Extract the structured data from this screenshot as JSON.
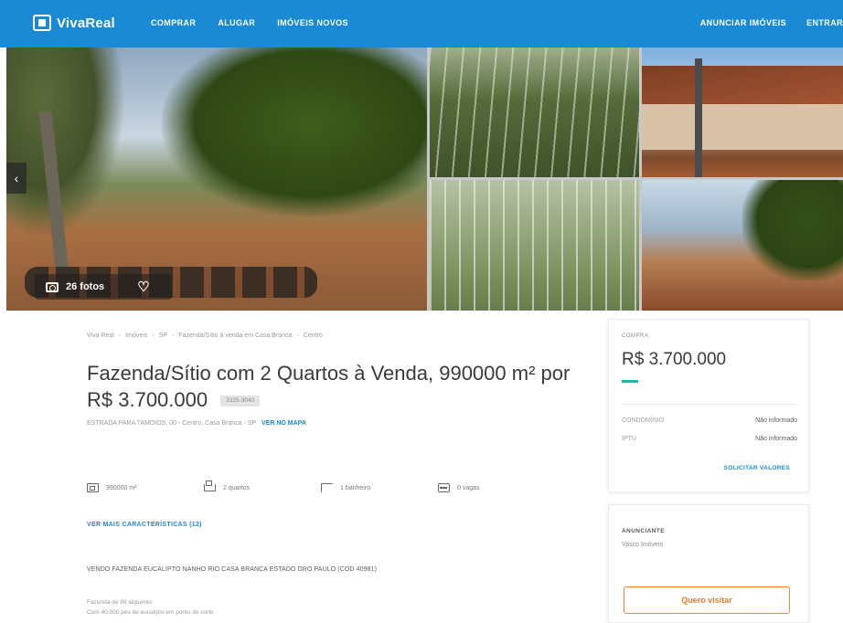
{
  "header": {
    "logo_text": "VivaReal",
    "nav_left": [
      "COMPRAR",
      "ALUGAR",
      "IMÓVEIS NOVOS"
    ],
    "nav_right": [
      "ANUNCIAR IMÓVEIS",
      "ENTRAR"
    ],
    "brand_color": "#1a8ad4"
  },
  "gallery": {
    "photo_count_label": "26 fotos",
    "prev_icon": "chevron-left-icon",
    "favorite_icon": "heart-icon",
    "camera_icon": "camera-icon"
  },
  "breadcrumb": [
    "Viva Real",
    "Imóveis",
    "SP",
    "Fazenda/Sítio à venda em Casa Branca",
    "Centro"
  ],
  "listing": {
    "title": "Fazenda/Sítio com 2 Quartos à Venda, 990000 m² por R$ 3.700.000",
    "code": "3325-3040",
    "address": "ESTRADA PARA TAMOIOS, 00 - Centro, Casa Branca - SP",
    "map_link": "VER NO MAPA",
    "amenities": [
      {
        "icon": "area-icon",
        "label": "990000 m²"
      },
      {
        "icon": "bed-icon",
        "label": "2 quartos"
      },
      {
        "icon": "bath-icon",
        "label": "1 banheiro"
      },
      {
        "icon": "car-icon",
        "label": "0 vagas"
      }
    ],
    "see_more": "VER MAIS CARACTERÍSTICAS (12)",
    "description_head": "VENDO FAZENDA EUCALIPTO NANHO RIO CASA BRANCA ESTADO DRO PAULO (COD 40981)",
    "description_lines": [
      "Fazenda de 99 alqueires",
      "Com 40.000 pés de eucalipto em ponto de corte"
    ]
  },
  "price_card": {
    "label": "COMPRA",
    "price": "R$ 3.700.000",
    "rows": [
      {
        "key": "CONDOMÍNIO",
        "value": "Não informado"
      },
      {
        "key": "IPTU",
        "value": "Não informado"
      }
    ],
    "link": "SOLICITAR VALORES",
    "accent_color": "#1fb8a0"
  },
  "advertiser_card": {
    "label": "ANUNCIANTE",
    "name": "Vasco Imóveis",
    "button": "Quero visitar",
    "button_color": "#f08a3a"
  }
}
